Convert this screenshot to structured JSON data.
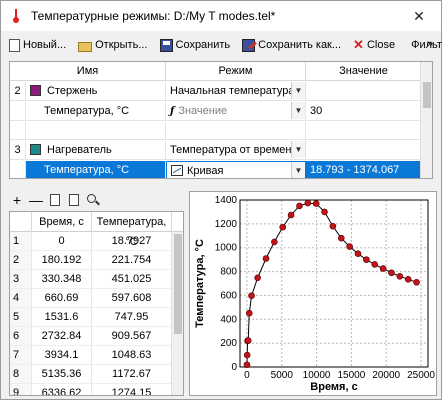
{
  "window": {
    "title": "Температурные режимы: D:/My T modes.tel*",
    "close_glyph": "✕"
  },
  "toolbar": {
    "new_label": "Новый...",
    "open_label": "Открыть...",
    "save_label": "Сохранить",
    "save_as_label": "Сохранить как...",
    "close_label": "Close",
    "close_glyph": "✕",
    "filters_label": "Фильтры:",
    "more_glyph": "»"
  },
  "grid": {
    "columns": [
      "Имя",
      "Режим",
      "Значение"
    ],
    "rows": [
      {
        "num": "2",
        "name": "Стержень",
        "swatch": "#8e1a7a",
        "mode": "Начальная температура",
        "value": ""
      },
      {
        "num": "",
        "name": "Температура, °C",
        "mode_icon_text": "ƒ",
        "mode": "Значение",
        "mode_grey": true,
        "value": "30"
      },
      {
        "num": "",
        "name": "",
        "mode": "",
        "value": ""
      },
      {
        "num": "3",
        "name": "Нагреватель",
        "swatch": "#1d8a8a",
        "mode": "Температура от времени",
        "value": ""
      },
      {
        "num": "",
        "name": "Температура, °C",
        "mode": "Кривая",
        "value": "18.793 - 1374.067",
        "selected": true
      }
    ],
    "dropdown_glyph": "▼"
  },
  "mini_toolbar": {
    "add": "+",
    "remove": "—"
  },
  "table": {
    "columns": [
      "Время, с",
      "Температура, °C"
    ],
    "rows": [
      [
        "1",
        "0",
        "18.7927"
      ],
      [
        "2",
        "180.192",
        "221.754"
      ],
      [
        "3",
        "330.348",
        "451.025"
      ],
      [
        "4",
        "660.69",
        "597.608"
      ],
      [
        "5",
        "1531.6",
        "747.95"
      ],
      [
        "6",
        "2732.84",
        "909.567"
      ],
      [
        "7",
        "3934.1",
        "1048.63"
      ],
      [
        "8",
        "5135.36",
        "1172.67"
      ],
      [
        "9",
        "6336.62",
        "1274.15"
      ]
    ]
  },
  "chart_data": {
    "type": "line",
    "xlabel": "Время, с",
    "ylabel": "Температура, °C",
    "xlim": [
      -1000,
      26000
    ],
    "ylim": [
      0,
      1400
    ],
    "xticks": [
      0,
      5000,
      10000,
      15000,
      20000,
      25000
    ],
    "yticks": [
      0,
      200,
      400,
      600,
      800,
      1000,
      1200,
      1400
    ],
    "grid": true,
    "line_color": "#000000",
    "marker_color": "#c0131a",
    "x": [
      0,
      30,
      90,
      180,
      330,
      660,
      1531.6,
      2732.84,
      3934.1,
      5135.36,
      6336.62,
      7538,
      8739,
      9940,
      11141,
      12343,
      13544,
      14745,
      15946,
      17148,
      18349,
      19550,
      20751,
      21953,
      23154,
      24355
    ],
    "y": [
      18.79,
      100,
      220,
      221.754,
      451.025,
      597.608,
      747.95,
      909.567,
      1048.63,
      1172.67,
      1274.15,
      1350,
      1374.07,
      1370,
      1300,
      1180,
      1080,
      1010,
      950,
      900,
      860,
      825,
      790,
      760,
      735,
      710
    ]
  }
}
